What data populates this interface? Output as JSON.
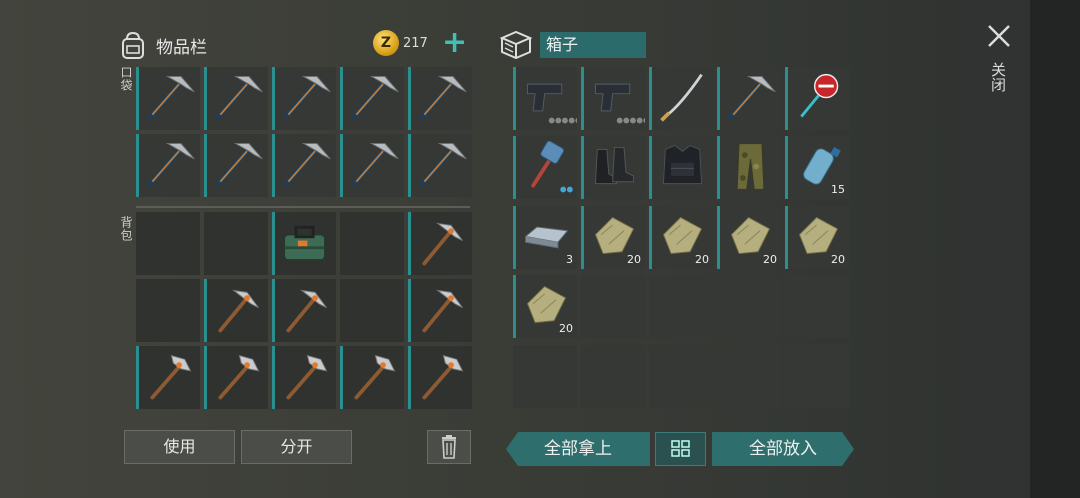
{
  "inventory": {
    "title": "物品栏",
    "coins": "217",
    "coin_symbol": "Z",
    "pocket_label": "口袋",
    "backpack_label": "背包",
    "use_label": "使用",
    "split_label": "分开"
  },
  "box": {
    "name": "箱子",
    "take_all_label": "全部拿上",
    "put_all_label": "全部放入"
  },
  "close_label": "关闭",
  "accent_color": "#2b8f8f",
  "pocket_slots": [
    "pickaxe",
    "pickaxe",
    "pickaxe",
    "pickaxe",
    "pickaxe",
    "pickaxe",
    "pickaxe",
    "pickaxe",
    "pickaxe",
    "pickaxe"
  ],
  "backpack_slots": [
    "empty",
    "empty",
    "toolbox",
    "empty",
    "stone-pickaxe",
    "empty",
    "stone-pickaxe",
    "stone-pickaxe",
    "empty",
    "stone-pickaxe",
    "stone-hammer",
    "stone-hammer",
    "stone-hammer",
    "stone-hammer",
    "stone-hammer"
  ],
  "box_slots": [
    {
      "item": "pistol",
      "qty": ""
    },
    {
      "item": "pistol",
      "qty": ""
    },
    {
      "item": "katana",
      "qty": ""
    },
    {
      "item": "pickaxe",
      "qty": ""
    },
    {
      "item": "stop-sign",
      "qty": ""
    },
    {
      "item": "sledgehammer",
      "qty": ""
    },
    {
      "item": "boots",
      "qty": ""
    },
    {
      "item": "tactical-vest",
      "qty": ""
    },
    {
      "item": "camo-pants",
      "qty": ""
    },
    {
      "item": "water-bottle",
      "qty": "15"
    },
    {
      "item": "iron-bar",
      "qty": "3"
    },
    {
      "item": "cloth",
      "qty": "20"
    },
    {
      "item": "cloth",
      "qty": "20"
    },
    {
      "item": "cloth",
      "qty": "20"
    },
    {
      "item": "cloth",
      "qty": "20"
    },
    {
      "item": "cloth",
      "qty": "20"
    },
    {
      "item": "empty",
      "qty": ""
    },
    {
      "item": "empty",
      "qty": ""
    },
    {
      "item": "empty",
      "qty": ""
    },
    {
      "item": "empty",
      "qty": ""
    },
    {
      "item": "empty",
      "qty": ""
    },
    {
      "item": "empty",
      "qty": ""
    },
    {
      "item": "empty",
      "qty": ""
    },
    {
      "item": "empty",
      "qty": ""
    },
    {
      "item": "empty",
      "qty": ""
    }
  ]
}
